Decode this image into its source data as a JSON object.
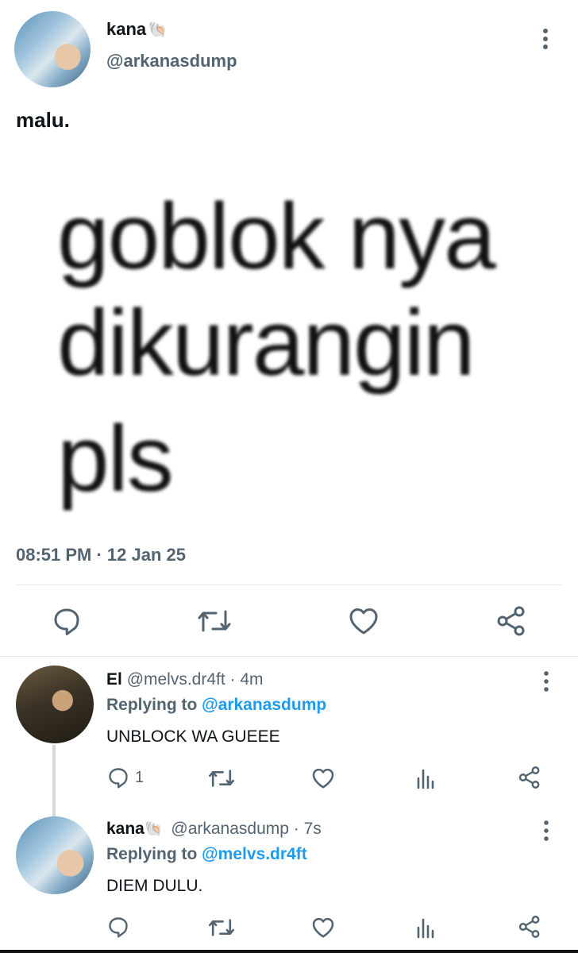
{
  "post": {
    "author_name": "kana",
    "author_emoji": "🐚",
    "author_handle": "@arkanasdump",
    "text": "malu.",
    "image_text_lines": [
      "goblok nya",
      "dikurangin",
      "pls"
    ],
    "timestamp": "08:51 PM · 12 Jan 25",
    "actions": [
      "reply-icon",
      "retweet-icon",
      "like-icon",
      "share-icon"
    ]
  },
  "replies": [
    {
      "name": "El",
      "handle_time": "@melvs.dr4ft · 4m",
      "replying_prefix": "Replying to ",
      "replying_to": "@arkanasdump",
      "text": "UNBLOCK WA GUEEE",
      "reply_count": "1"
    },
    {
      "name": "kana",
      "emoji": "🐚",
      "handle_time": "@arkanasdump · 7s",
      "replying_prefix": "Replying to ",
      "replying_to": "@melvs.dr4ft",
      "text": "DIEM DULU."
    }
  ],
  "colors": {
    "accent": "#1d9bf0",
    "muted": "#536471",
    "text": "#0f1419"
  }
}
